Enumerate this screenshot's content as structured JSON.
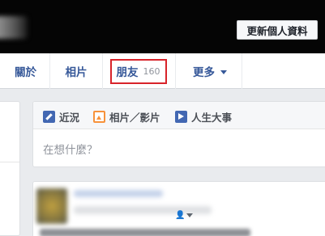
{
  "profile": {
    "update_info_label": "更新個人資料"
  },
  "tabs": {
    "about": "關於",
    "photos": "相片",
    "friends": "朋友",
    "friends_count": "160",
    "more": "更多"
  },
  "composer": {
    "status": "近況",
    "photo_video": "相片／影片",
    "life_event": "人生大事",
    "placeholder": "在想什麼？"
  },
  "post": {
    "audience_icon": "👤"
  },
  "colors": {
    "link_blue": "#365899",
    "highlight_red": "#d8232a",
    "photo_orange": "#f7923b"
  }
}
